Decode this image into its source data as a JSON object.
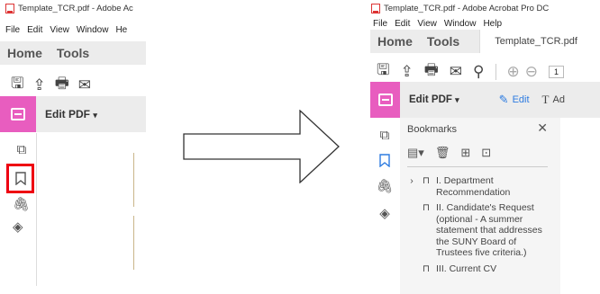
{
  "left": {
    "window_title": "Template_TCR.pdf - Adobe Ac",
    "menu": [
      "File",
      "Edit",
      "View",
      "Window",
      "He"
    ],
    "nav": {
      "home": "Home",
      "tools": "Tools"
    },
    "edit_pdf": "Edit PDF",
    "dropdown": "▾"
  },
  "right": {
    "window_title": "Template_TCR.pdf - Adobe Acrobat Pro DC",
    "menu": [
      "File",
      "Edit",
      "View",
      "Window",
      "Help"
    ],
    "nav": {
      "home": "Home",
      "tools": "Tools"
    },
    "tab": "Template_TCR.pdf",
    "tab_close": "×",
    "page_number": "1",
    "edit_pdf": "Edit PDF",
    "dropdown": "▾",
    "edit_button": "Edit",
    "add_text": "Ad",
    "panel_title": "Bookmarks",
    "panel_close": "✕",
    "bookmarks": [
      "I. Department Recommendation",
      "II. Candidate's Request (optional - A summer statement that addresses the SUNY Board of Trustees five criteria.)",
      "III. Current CV"
    ]
  },
  "colors": {
    "accent": "#e85dbf",
    "highlight": "#e01111",
    "bookmark_blue": "#2d7be0"
  }
}
